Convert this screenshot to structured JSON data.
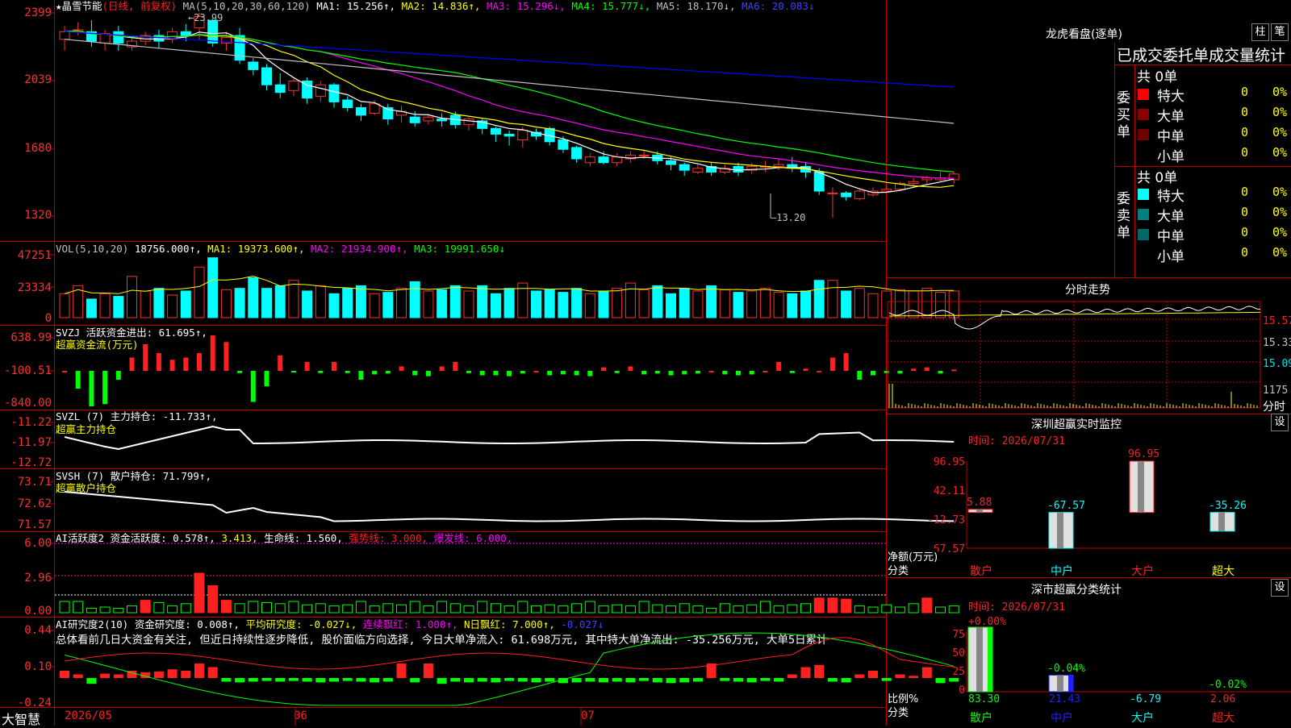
{
  "header": {
    "stock_name": "★晶雪节能",
    "period": "(日线, 前复权)",
    "ma_label": "MA(5,10,20,30,60,120)",
    "ma1": "MA1: 15.256↑,",
    "ma2": "MA2: 14.836↑,",
    "ma3": "MA3: 15.296↓,",
    "ma4": "MA4: 15.777↓,",
    "ma5": "MA5: 18.170↓,",
    "ma6": "MA6: 20.083↓"
  },
  "price_axis": [
    "2399",
    "2039",
    "1680",
    "1320"
  ],
  "price_annot": {
    "high": "23.99",
    "low": "13.20"
  },
  "vol": {
    "title": "VOL(5,10,20)",
    "value": "18756.000↑,",
    "ma1": "MA1: 19373.600↑,",
    "ma2": "MA2: 21934.900↑,",
    "ma3": "MA3: 19991.650↓",
    "axis": [
      "47251",
      "23334",
      "0"
    ]
  },
  "svzj": {
    "title": "SVZJ  活跃资金进出: 61.695↑,",
    "sub": "超赢资金流(万元)",
    "axis": [
      "638.99",
      "-100.51",
      "-840.00"
    ]
  },
  "svzl": {
    "title": "SVZL (7) 主力持仓: -11.733↑,",
    "sub": "超赢主力持仓",
    "axis": [
      "-11.22",
      "-11.97",
      "-12.72"
    ]
  },
  "svsh": {
    "title": "SVSH (7) 散户持仓: 71.799↑,",
    "sub": "超赢散户持仓",
    "axis": [
      "73.71",
      "72.62",
      "71.57"
    ]
  },
  "ai_active": {
    "title": "AI活跃度2 资金活跃度: 0.578↑,",
    "v2": "3.413,",
    "v3": "生命线: 1.560,",
    "v4": "强势线: 3.000,",
    "v5": "爆发线: 6.000,",
    "axis": [
      "6.00",
      "2.96",
      "0.00"
    ]
  },
  "ai_research": {
    "title": "AI研究度2(10) 资金研究度: 0.008↑,",
    "v2": "平均研究度: -0.027↓,",
    "v3": "连续飘红: 1.000↑,",
    "v4": "N日飘红: 7.000↑,",
    "v5": "-0.027↓",
    "comment": "总体看前几日大资金有关注, 但近日持续性逐步降低, 股价面临方向选择, 今日大单净流入: 61.698万元, 其中特大单净流出: -35.256万元, 大单5日累计",
    "axis": [
      "0.44",
      "0.10",
      "-0.24"
    ]
  },
  "date_axis": {
    "brand": "大智慧",
    "labels": [
      "2026/05",
      "06",
      "07"
    ]
  },
  "longhu": {
    "title": "龙虎看盘(逐单)",
    "btn1": "柱",
    "btn2": "笔",
    "header": "已成交委托单成交量统计",
    "buy_label": "委买单",
    "sell_label": "委卖单",
    "buy_count": "共 0单",
    "sell_count": "共 0单",
    "rows": [
      {
        "name": "特大",
        "val": "0",
        "pct": "0%"
      },
      {
        "name": "大单",
        "val": "0",
        "pct": "0%"
      },
      {
        "name": "中单",
        "val": "0",
        "pct": "0%"
      },
      {
        "name": "小单",
        "val": "0",
        "pct": "0%"
      }
    ],
    "sell_rows": [
      {
        "name": "特大",
        "val": "0",
        "pct": "0%"
      },
      {
        "name": "大单",
        "val": "0",
        "pct": "0%"
      },
      {
        "name": "中单",
        "val": "0",
        "pct": "0%"
      },
      {
        "name": "小单",
        "val": "0",
        "pct": "0%"
      }
    ]
  },
  "intraday": {
    "title": "分时走势",
    "axis": [
      "15.57",
      "15.33",
      "15.09"
    ],
    "vol_axis": "1175",
    "footer": "分时"
  },
  "sz_monitor": {
    "title": "深圳超赢实时监控",
    "btn": "设",
    "time": "时间: 2026/07/31",
    "axis": [
      "96.95",
      "42.11",
      "-12.73",
      "-67.57"
    ],
    "ylabel1": "净额(万元)",
    "ylabel2": "分类",
    "bars": [
      {
        "label": "散户",
        "value": "5.88"
      },
      {
        "label": "中户",
        "value": "-67.57"
      },
      {
        "label": "大户",
        "value": "96.95"
      },
      {
        "label": "超大",
        "value": "-35.26"
      }
    ]
  },
  "sz_class": {
    "title": "深市超赢分类统计",
    "btn": "设",
    "time": "时间: 2026/07/31",
    "axis": [
      "75",
      "50",
      "25",
      "0"
    ],
    "ylabel1": "比例%",
    "ylabel2": "分类",
    "tops": [
      "+0.00%",
      "-0.04%",
      "-0.02%"
    ],
    "values": [
      "83.30",
      "21.43",
      "-6.79",
      "2.06"
    ],
    "labels": [
      "散户",
      "中户",
      "大户",
      "超大"
    ]
  },
  "chart_data": {
    "type": "candlestick",
    "ylim": [
      1300,
      2420
    ],
    "candles": [
      [
        22.6,
        23.0,
        22.0,
        23.3
      ],
      [
        23.0,
        23.1,
        22.8,
        23.5
      ],
      [
        23.0,
        22.5,
        22.2,
        23.6
      ],
      [
        22.4,
        22.9,
        22.0,
        23.1
      ],
      [
        23.0,
        22.4,
        22.0,
        23.3
      ],
      [
        22.2,
        22.5,
        22.0,
        22.8
      ],
      [
        22.5,
        22.8,
        22.3,
        23.0
      ],
      [
        22.8,
        22.5,
        22.1,
        23.1
      ],
      [
        22.6,
        23.0,
        22.4,
        23.2
      ],
      [
        23.0,
        22.8,
        22.5,
        23.4
      ],
      [
        23.2,
        23.8,
        22.6,
        23.99
      ],
      [
        23.6,
        22.4,
        22.2,
        23.7
      ],
      [
        22.4,
        22.7,
        22.0,
        23.0
      ],
      [
        22.8,
        21.5,
        21.3,
        23.2
      ],
      [
        21.4,
        21.0,
        20.7,
        21.6
      ],
      [
        21.1,
        20.2,
        19.9,
        21.3
      ],
      [
        20.2,
        19.8,
        19.5,
        20.8
      ],
      [
        19.9,
        20.4,
        19.6,
        20.5
      ],
      [
        20.4,
        19.5,
        19.2,
        20.6
      ],
      [
        19.6,
        20.2,
        19.3,
        20.4
      ],
      [
        20.2,
        19.3,
        19.0,
        20.3
      ],
      [
        19.4,
        19.0,
        18.8,
        19.6
      ],
      [
        19.0,
        18.6,
        18.3,
        19.2
      ],
      [
        18.7,
        19.2,
        18.6,
        19.4
      ],
      [
        19.0,
        18.4,
        18.1,
        19.2
      ],
      [
        18.6,
        18.8,
        18.2,
        19.1
      ],
      [
        18.5,
        18.2,
        18.0,
        18.8
      ],
      [
        18.3,
        18.5,
        18.1,
        18.7
      ],
      [
        18.4,
        18.3,
        18.0,
        18.7
      ],
      [
        18.6,
        18.1,
        17.9,
        18.8
      ],
      [
        18.1,
        18.4,
        17.8,
        18.5
      ],
      [
        18.3,
        17.9,
        17.6,
        18.4
      ],
      [
        17.9,
        17.6,
        17.2,
        18.0
      ],
      [
        17.6,
        17.5,
        17.0,
        17.8
      ],
      [
        17.3,
        17.8,
        16.9,
        18.0
      ],
      [
        17.7,
        17.5,
        17.3,
        17.9
      ],
      [
        17.9,
        17.2,
        17.0,
        18.0
      ],
      [
        17.3,
        16.8,
        16.6,
        17.5
      ],
      [
        16.9,
        16.3,
        16.1,
        17.0
      ],
      [
        16.1,
        16.4,
        15.9,
        16.6
      ],
      [
        16.4,
        16.1,
        16.0,
        16.7
      ],
      [
        16.1,
        16.4,
        15.9,
        16.6
      ],
      [
        16.3,
        16.5,
        16.1,
        16.7
      ],
      [
        16.5,
        16.5,
        16.3,
        16.8
      ],
      [
        16.5,
        16.2,
        16.0,
        16.7
      ],
      [
        16.2,
        16.0,
        15.7,
        16.4
      ],
      [
        16.0,
        15.7,
        15.4,
        16.1
      ],
      [
        15.6,
        15.8,
        15.5,
        16.0
      ],
      [
        15.9,
        15.6,
        15.4,
        16.1
      ],
      [
        15.6,
        15.8,
        15.5,
        16.0
      ],
      [
        15.9,
        15.6,
        15.4,
        16.1
      ],
      [
        15.7,
        15.9,
        15.5,
        16.1
      ],
      [
        15.9,
        15.9,
        15.6,
        16.2
      ],
      [
        15.9,
        16.0,
        15.7,
        16.3
      ],
      [
        16.0,
        15.8,
        15.6,
        16.4
      ],
      [
        15.9,
        15.6,
        15.3,
        16.1
      ],
      [
        15.6,
        14.6,
        14.4,
        15.8
      ],
      [
        14.5,
        14.5,
        13.2,
        14.8
      ],
      [
        14.5,
        14.3,
        14.1,
        14.6
      ],
      [
        14.2,
        14.6,
        14.1,
        14.7
      ],
      [
        14.4,
        14.6,
        14.3,
        14.8
      ],
      [
        14.6,
        14.7,
        14.5,
        14.9
      ],
      [
        14.7,
        15.0,
        14.6,
        15.1
      ],
      [
        15.0,
        15.1,
        14.8,
        15.3
      ],
      [
        15.2,
        15.3,
        15.0,
        15.4
      ],
      [
        15.2,
        15.3,
        15.1,
        15.6
      ],
      [
        15.2,
        15.5,
        15.0,
        15.6
      ]
    ],
    "ma_colors": [
      "#ffffff",
      "#ffff00",
      "#ff00ff",
      "#00ff00",
      "#c0c0c0",
      "#0000ff"
    ]
  }
}
